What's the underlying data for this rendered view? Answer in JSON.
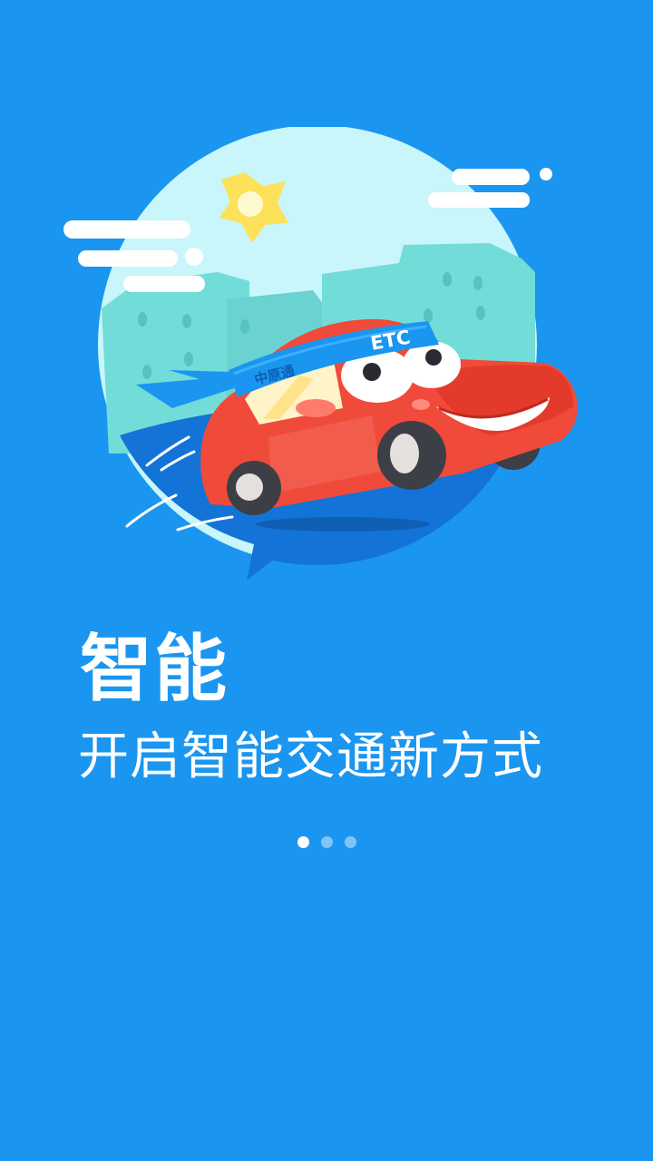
{
  "onboarding": {
    "title": "智能",
    "subtitle": "开启智能交通新方式",
    "banner_label": "ETC",
    "banner_brand": "中原通",
    "pages": 3,
    "active_page": 1
  },
  "colors": {
    "background": "#1a96f0",
    "car": "#f04a3a",
    "sky": "#c9f6fb",
    "ground": "#1473d6",
    "sun": "#fde15a"
  },
  "icons": {
    "illustration": "etc-car-illustration",
    "sun": "sun-icon",
    "cloud": "cloud-icon"
  }
}
